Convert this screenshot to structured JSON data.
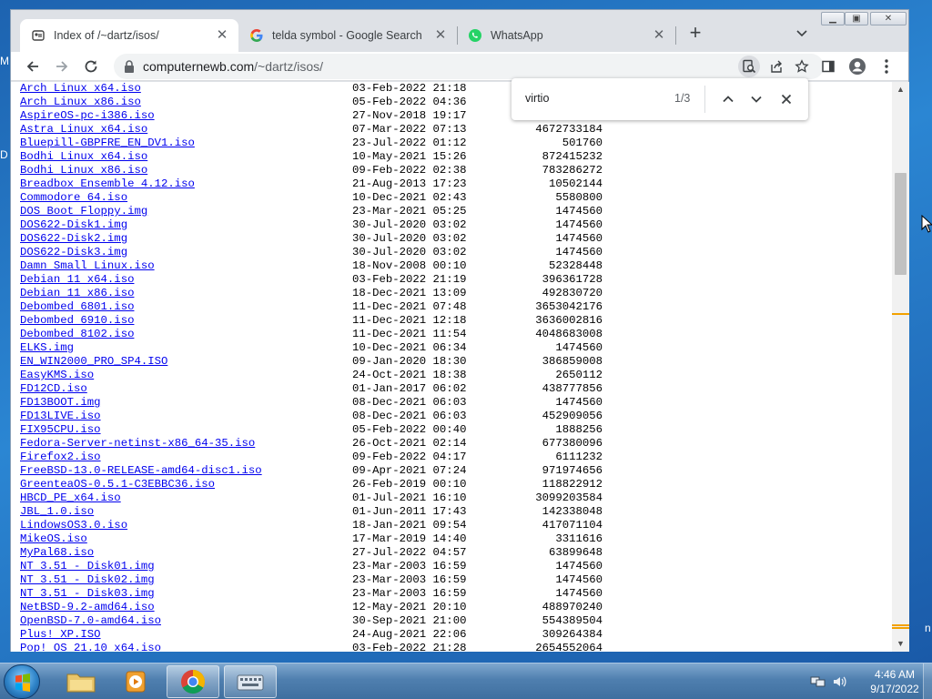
{
  "desktop": {
    "peek_m": "M",
    "peek_d": "D",
    "peek_n": "n"
  },
  "tabs": [
    {
      "title": "Index of /~dartz/isos/",
      "active": true
    },
    {
      "title": "telda symbol - Google Search",
      "active": false
    },
    {
      "title": "WhatsApp",
      "active": false
    }
  ],
  "address_bar": {
    "host": "computernewb.com",
    "path": "/~dartz/isos/"
  },
  "find_bar": {
    "query": "virtio",
    "match_count": "1/3"
  },
  "listing": [
    {
      "name": "Arch Linux x64.iso",
      "date": "03-Feb-2022 21:18",
      "size": ""
    },
    {
      "name": "Arch Linux x86.iso",
      "date": "05-Feb-2022 04:36",
      "size": ""
    },
    {
      "name": "AspireOS-pc-i386.iso",
      "date": "27-Nov-2018 19:17",
      "size": ""
    },
    {
      "name": "Astra Linux x64.iso",
      "date": "07-Mar-2022 07:13",
      "size": "4672733184"
    },
    {
      "name": "Bluepill-GBPFRE_EN_DV1.iso",
      "date": "23-Jul-2022 01:12",
      "size": "501760"
    },
    {
      "name": "Bodhi Linux x64.iso",
      "date": "10-May-2021 15:26",
      "size": "872415232"
    },
    {
      "name": "Bodhi Linux x86.iso",
      "date": "09-Feb-2022 02:38",
      "size": "783286272"
    },
    {
      "name": "Breadbox Ensemble 4.12.iso",
      "date": "21-Aug-2013 17:23",
      "size": "10502144"
    },
    {
      "name": "Commodore 64.iso",
      "date": "10-Dec-2021 02:43",
      "size": "5580800"
    },
    {
      "name": "DOS Boot Floppy.img",
      "date": "23-Mar-2021 05:25",
      "size": "1474560"
    },
    {
      "name": "DOS622-Disk1.img",
      "date": "30-Jul-2020 03:02",
      "size": "1474560"
    },
    {
      "name": "DOS622-Disk2.img",
      "date": "30-Jul-2020 03:02",
      "size": "1474560"
    },
    {
      "name": "DOS622-Disk3.img",
      "date": "30-Jul-2020 03:02",
      "size": "1474560"
    },
    {
      "name": "Damn Small Linux.iso",
      "date": "18-Nov-2008 00:10",
      "size": "52328448"
    },
    {
      "name": "Debian 11 x64.iso",
      "date": "03-Feb-2022 21:19",
      "size": "396361728"
    },
    {
      "name": "Debian 11 x86.iso",
      "date": "18-Dec-2021 13:09",
      "size": "492830720"
    },
    {
      "name": "Debombed 6801.iso",
      "date": "11-Dec-2021 07:48",
      "size": "3653042176"
    },
    {
      "name": "Debombed 6910.iso",
      "date": "11-Dec-2021 12:18",
      "size": "3636002816"
    },
    {
      "name": "Debombed 8102.iso",
      "date": "11-Dec-2021 11:54",
      "size": "4048683008"
    },
    {
      "name": "ELKS.img",
      "date": "10-Dec-2021 06:34",
      "size": "1474560"
    },
    {
      "name": "EN_WIN2000_PRO_SP4.ISO",
      "date": "09-Jan-2020 18:30",
      "size": "386859008"
    },
    {
      "name": "EasyKMS.iso",
      "date": "24-Oct-2021 18:38",
      "size": "2650112"
    },
    {
      "name": "FD12CD.iso",
      "date": "01-Jan-2017 06:02",
      "size": "438777856"
    },
    {
      "name": "FD13BOOT.img",
      "date": "08-Dec-2021 06:03",
      "size": "1474560"
    },
    {
      "name": "FD13LIVE.iso",
      "date": "08-Dec-2021 06:03",
      "size": "452909056"
    },
    {
      "name": "FIX95CPU.iso",
      "date": "05-Feb-2022 00:40",
      "size": "1888256"
    },
    {
      "name": "Fedora-Server-netinst-x86_64-35.iso",
      "date": "26-Oct-2021 02:14",
      "size": "677380096"
    },
    {
      "name": "Firefox2.iso",
      "date": "09-Feb-2022 04:17",
      "size": "6111232"
    },
    {
      "name": "FreeBSD-13.0-RELEASE-amd64-disc1.iso",
      "date": "09-Apr-2021 07:24",
      "size": "971974656"
    },
    {
      "name": "GreenteaOS-0.5.1-C3EBBC36.iso",
      "date": "26-Feb-2019 00:10",
      "size": "118822912"
    },
    {
      "name": "HBCD_PE_x64.iso",
      "date": "01-Jul-2021 16:10",
      "size": "3099203584"
    },
    {
      "name": "JBL_1.0.iso",
      "date": "01-Jun-2011 17:43",
      "size": "142338048"
    },
    {
      "name": "LindowsOS3.0.iso",
      "date": "18-Jan-2021 09:54",
      "size": "417071104"
    },
    {
      "name": "MikeOS.iso",
      "date": "17-Mar-2019 14:40",
      "size": "3311616"
    },
    {
      "name": "MyPal68.iso",
      "date": "27-Jul-2022 04:57",
      "size": "63899648"
    },
    {
      "name": "NT 3.51 - Disk01.img",
      "date": "23-Mar-2003 16:59",
      "size": "1474560"
    },
    {
      "name": "NT 3.51 - Disk02.img",
      "date": "23-Mar-2003 16:59",
      "size": "1474560"
    },
    {
      "name": "NT 3.51 - Disk03.img",
      "date": "23-Mar-2003 16:59",
      "size": "1474560"
    },
    {
      "name": "NetBSD-9.2-amd64.iso",
      "date": "12-May-2021 20:10",
      "size": "488970240"
    },
    {
      "name": "OpenBSD-7.0-amd64.iso",
      "date": "30-Sep-2021 21:00",
      "size": "554389504"
    },
    {
      "name": "Plus! XP.ISO",
      "date": "24-Aug-2021 22:06",
      "size": "309264384"
    },
    {
      "name": "Pop! OS 21.10 x64.iso",
      "date": "03-Feb-2022 21:28",
      "size": "2654552064"
    }
  ],
  "taskbar": {
    "time": "4:46 AM",
    "date": "9/17/2022"
  },
  "colors": {
    "link": "#0000ee",
    "find_marker": "#f2a100",
    "chrome_frame": "#dee1e6"
  }
}
